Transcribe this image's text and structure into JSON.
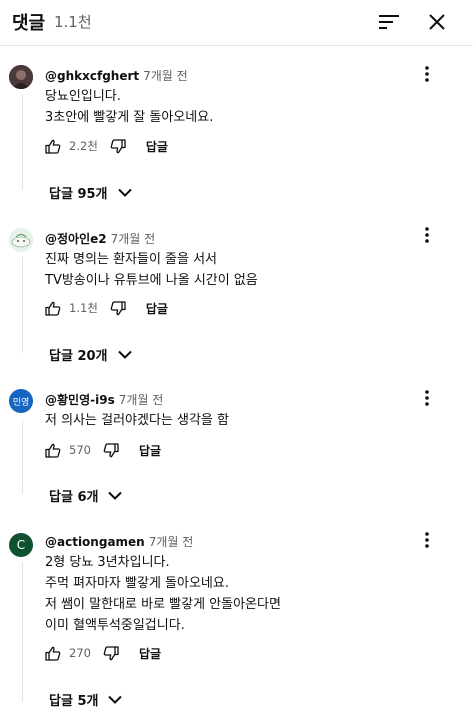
{
  "header": {
    "title": "댓글",
    "count": "1.1천"
  },
  "comments": [
    {
      "handle": "@ghkxcfghert",
      "time": "7개월 전",
      "lines": [
        "당뇨인입니다.",
        "3초안에 빨갛게 잘 돌아오네요."
      ],
      "likes": "2.2천",
      "reply_label": "답글",
      "replies_label": "답글 95개",
      "avatar": {
        "type": "photo",
        "color": "#3a2f2f"
      }
    },
    {
      "handle": "@정아인e2",
      "time": "7개월 전",
      "lines": [
        "진짜 명의는 환자들이 줄을 서서",
        "TV방송이나 유튜브에 나올 시간이 없음"
      ],
      "likes": "1.1천",
      "reply_label": "답글",
      "replies_label": "답글 20개",
      "avatar": {
        "type": "illustration",
        "color": "#dff0e4"
      }
    },
    {
      "handle": "@황민영-i9s",
      "time": "7개월 전",
      "lines": [
        "저 의사는 걸러야겠다는 생각을 함"
      ],
      "likes": "570",
      "reply_label": "답글",
      "replies_label": "답글 6개",
      "avatar": {
        "type": "text",
        "text": "민영",
        "color": "#1565c0"
      }
    },
    {
      "handle": "@actiongamen",
      "time": "7개월 전",
      "lines": [
        "2형 당뇨 3년차입니다.",
        "주먹 펴자마자 빨갛게 돌아오네요.",
        "저 쌤이 말한대로 바로 빨갛게 안돌아온다면",
        "이미 혈액투석중일겁니다."
      ],
      "likes": "270",
      "reply_label": "답글",
      "replies_label": "답글 5개",
      "avatar": {
        "type": "text",
        "text": "C",
        "color": "#0f5132"
      }
    }
  ],
  "icons": {
    "sort": "sort-icon",
    "close": "close-icon",
    "more": "more-vert-icon",
    "like": "thumb-up-icon",
    "dislike": "thumb-down-icon",
    "expand": "chevron-down-icon"
  }
}
